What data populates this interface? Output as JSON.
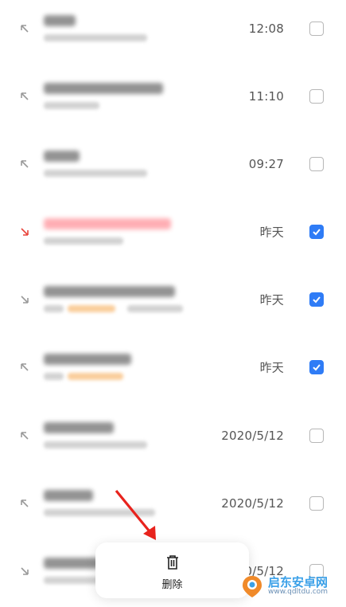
{
  "rows": [
    {
      "time": "12:08",
      "checked": false,
      "direction": "outgoing",
      "arrow_color": "#9a9a9a"
    },
    {
      "time": "11:10",
      "checked": false,
      "direction": "outgoing",
      "arrow_color": "#9a9a9a"
    },
    {
      "time": "09:27",
      "checked": false,
      "direction": "outgoing",
      "arrow_color": "#9a9a9a"
    },
    {
      "time": "昨天",
      "checked": true,
      "direction": "missed",
      "arrow_color": "#e8453c"
    },
    {
      "time": "昨天",
      "checked": true,
      "direction": "incoming",
      "arrow_color": "#9a9a9a"
    },
    {
      "time": "昨天",
      "checked": true,
      "direction": "outgoing",
      "arrow_color": "#9a9a9a"
    },
    {
      "time": "2020/5/12",
      "checked": false,
      "direction": "outgoing",
      "arrow_color": "#9a9a9a"
    },
    {
      "time": "2020/5/12",
      "checked": false,
      "direction": "outgoing",
      "arrow_color": "#9a9a9a"
    },
    {
      "time": "2020/5/12",
      "checked": false,
      "direction": "incoming",
      "arrow_color": "#9a9a9a"
    }
  ],
  "bottom_bar": {
    "delete_label": "删除",
    "icon": "trash-icon"
  },
  "watermark": {
    "name": "启东安卓网",
    "url": "www.qdltdu.com"
  },
  "colors": {
    "accent": "#2f7cf6",
    "missed": "#e8453c"
  }
}
